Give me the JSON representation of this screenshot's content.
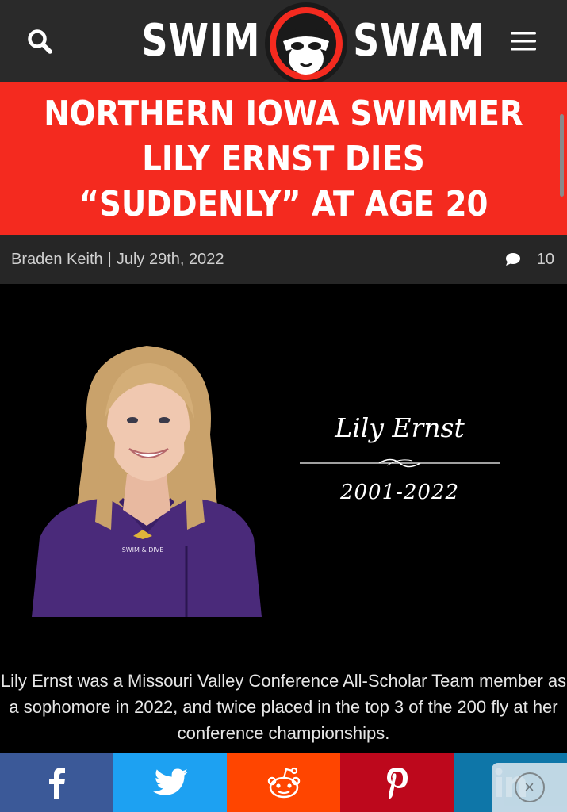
{
  "header": {
    "logo_left": "SWIM",
    "logo_right": "SWAM"
  },
  "article": {
    "title": "NORTHERN IOWA SWIMMER LILY ERNST DIES “SUDDENLY” AT AGE 20",
    "author": "Braden Keith",
    "separator": "|",
    "date": "July 29th, 2022",
    "comment_count": "10"
  },
  "memorial": {
    "name": "Lily Ernst",
    "years": "2001-2022",
    "jacket_text": "SWIM & DIVE"
  },
  "caption": "Lily Ernst was a Missouri Valley Conference All-Scholar Team member as a sophomore in 2022, and twice placed in the top 3 of the 200 fly at her conference championships.",
  "share": {
    "facebook_icon": "facebook-icon",
    "twitter_icon": "twitter-icon",
    "reddit_icon": "reddit-icon",
    "pinterest_icon": "pinterest-icon",
    "linkedin_icon": "linkedin-icon"
  },
  "colors": {
    "header_bg": "#2a2a2a",
    "title_banner_bg": "#f42a1f",
    "meta_bg": "#262626",
    "facebook": "#3b5998",
    "twitter": "#1da1f2",
    "reddit": "#ff4500",
    "pinterest": "#bd081c",
    "linkedin": "#0e76a8"
  }
}
